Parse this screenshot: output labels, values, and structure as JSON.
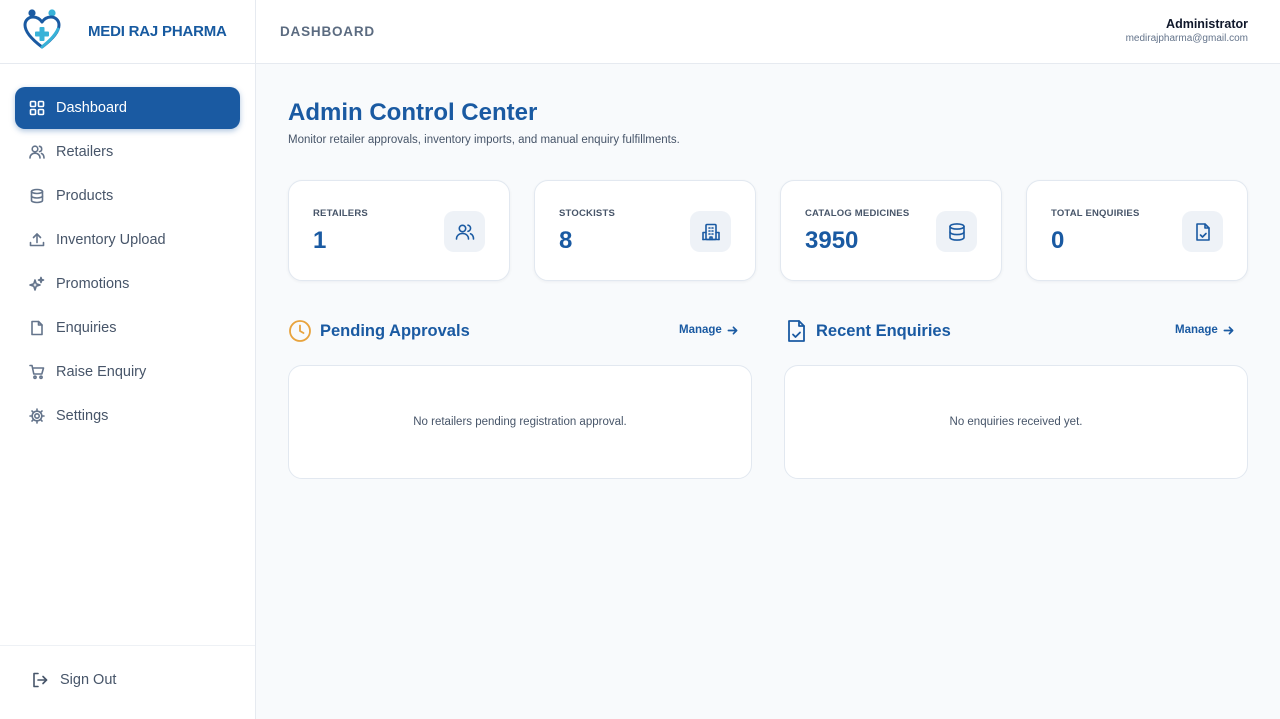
{
  "brand": {
    "name": "MEDI RAJ PHARMA",
    "logo_icon": "heart-plus-logo"
  },
  "sidebar": {
    "items": [
      {
        "label": "Dashboard",
        "icon": "grid-icon",
        "active": true
      },
      {
        "label": "Retailers",
        "icon": "users-icon",
        "active": false
      },
      {
        "label": "Products",
        "icon": "database-icon",
        "active": false
      },
      {
        "label": "Inventory Upload",
        "icon": "upload-icon",
        "active": false
      },
      {
        "label": "Promotions",
        "icon": "sparkles-icon",
        "active": false
      },
      {
        "label": "Enquiries",
        "icon": "file-icon",
        "active": false
      },
      {
        "label": "Raise Enquiry",
        "icon": "cart-icon",
        "active": false
      },
      {
        "label": "Settings",
        "icon": "gear-icon",
        "active": false
      }
    ],
    "signout_label": "Sign Out"
  },
  "header": {
    "breadcrumb": "DASHBOARD",
    "user_name": "Administrator",
    "user_email": "medirajpharma@gmail.com"
  },
  "main": {
    "title": "Admin Control Center",
    "subtitle": "Monitor retailer approvals, inventory imports, and manual enquiry fulfillments.",
    "stats": [
      {
        "label": "RETAILERS",
        "value": "1",
        "icon": "users-icon"
      },
      {
        "label": "STOCKISTS",
        "value": "8",
        "icon": "building-icon"
      },
      {
        "label": "CATALOG MEDICINES",
        "value": "3950",
        "icon": "database-icon"
      },
      {
        "label": "TOTAL ENQUIRIES",
        "value": "0",
        "icon": "file-check-icon"
      }
    ],
    "pending": {
      "title": "Pending Approvals",
      "manage_label": "Manage",
      "empty_text": "No retailers pending registration approval."
    },
    "enquiries": {
      "title": "Recent Enquiries",
      "manage_label": "Manage",
      "empty_text": "No enquiries received yet."
    }
  },
  "colors": {
    "primary": "#1a5aa2",
    "accent_clock": "#e8a33d",
    "background": "#f8fafc"
  }
}
